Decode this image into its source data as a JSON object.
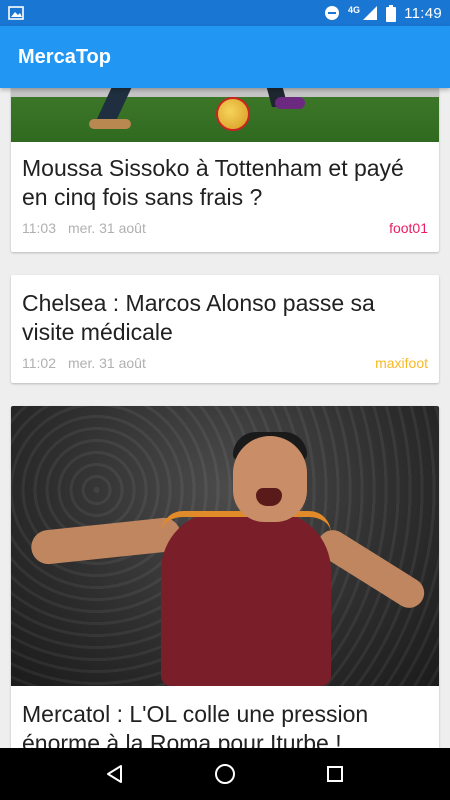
{
  "status_bar": {
    "time": "11:49",
    "network": "4G",
    "icons": [
      "image-icon",
      "do-not-disturb-icon",
      "signal-icon",
      "battery-icon"
    ]
  },
  "app_bar": {
    "title": "MercaTop"
  },
  "articles": [
    {
      "title": "Moussa Sissoko à Tottenham et payé en cinq fois sans frais ?",
      "time": "11:03",
      "date": "mer. 31 août",
      "source": "foot01",
      "source_color": "#e91e63",
      "has_image": true
    },
    {
      "title": "Chelsea : Marcos Alonso passe sa visite médicale",
      "time": "11:02",
      "date": "mer. 31 août",
      "source": "maxifoot",
      "source_color": "#f9b826",
      "has_image": false
    },
    {
      "title": "Mercatol : L'OL colle une pression énorme à la Roma pour Iturbe !",
      "has_image": true
    }
  ],
  "nav_bar": {
    "buttons": [
      "back-icon",
      "home-icon",
      "recents-icon"
    ]
  },
  "colors": {
    "status_bar": "#1976d2",
    "app_bar": "#2196f3",
    "background": "#eeeeee"
  }
}
